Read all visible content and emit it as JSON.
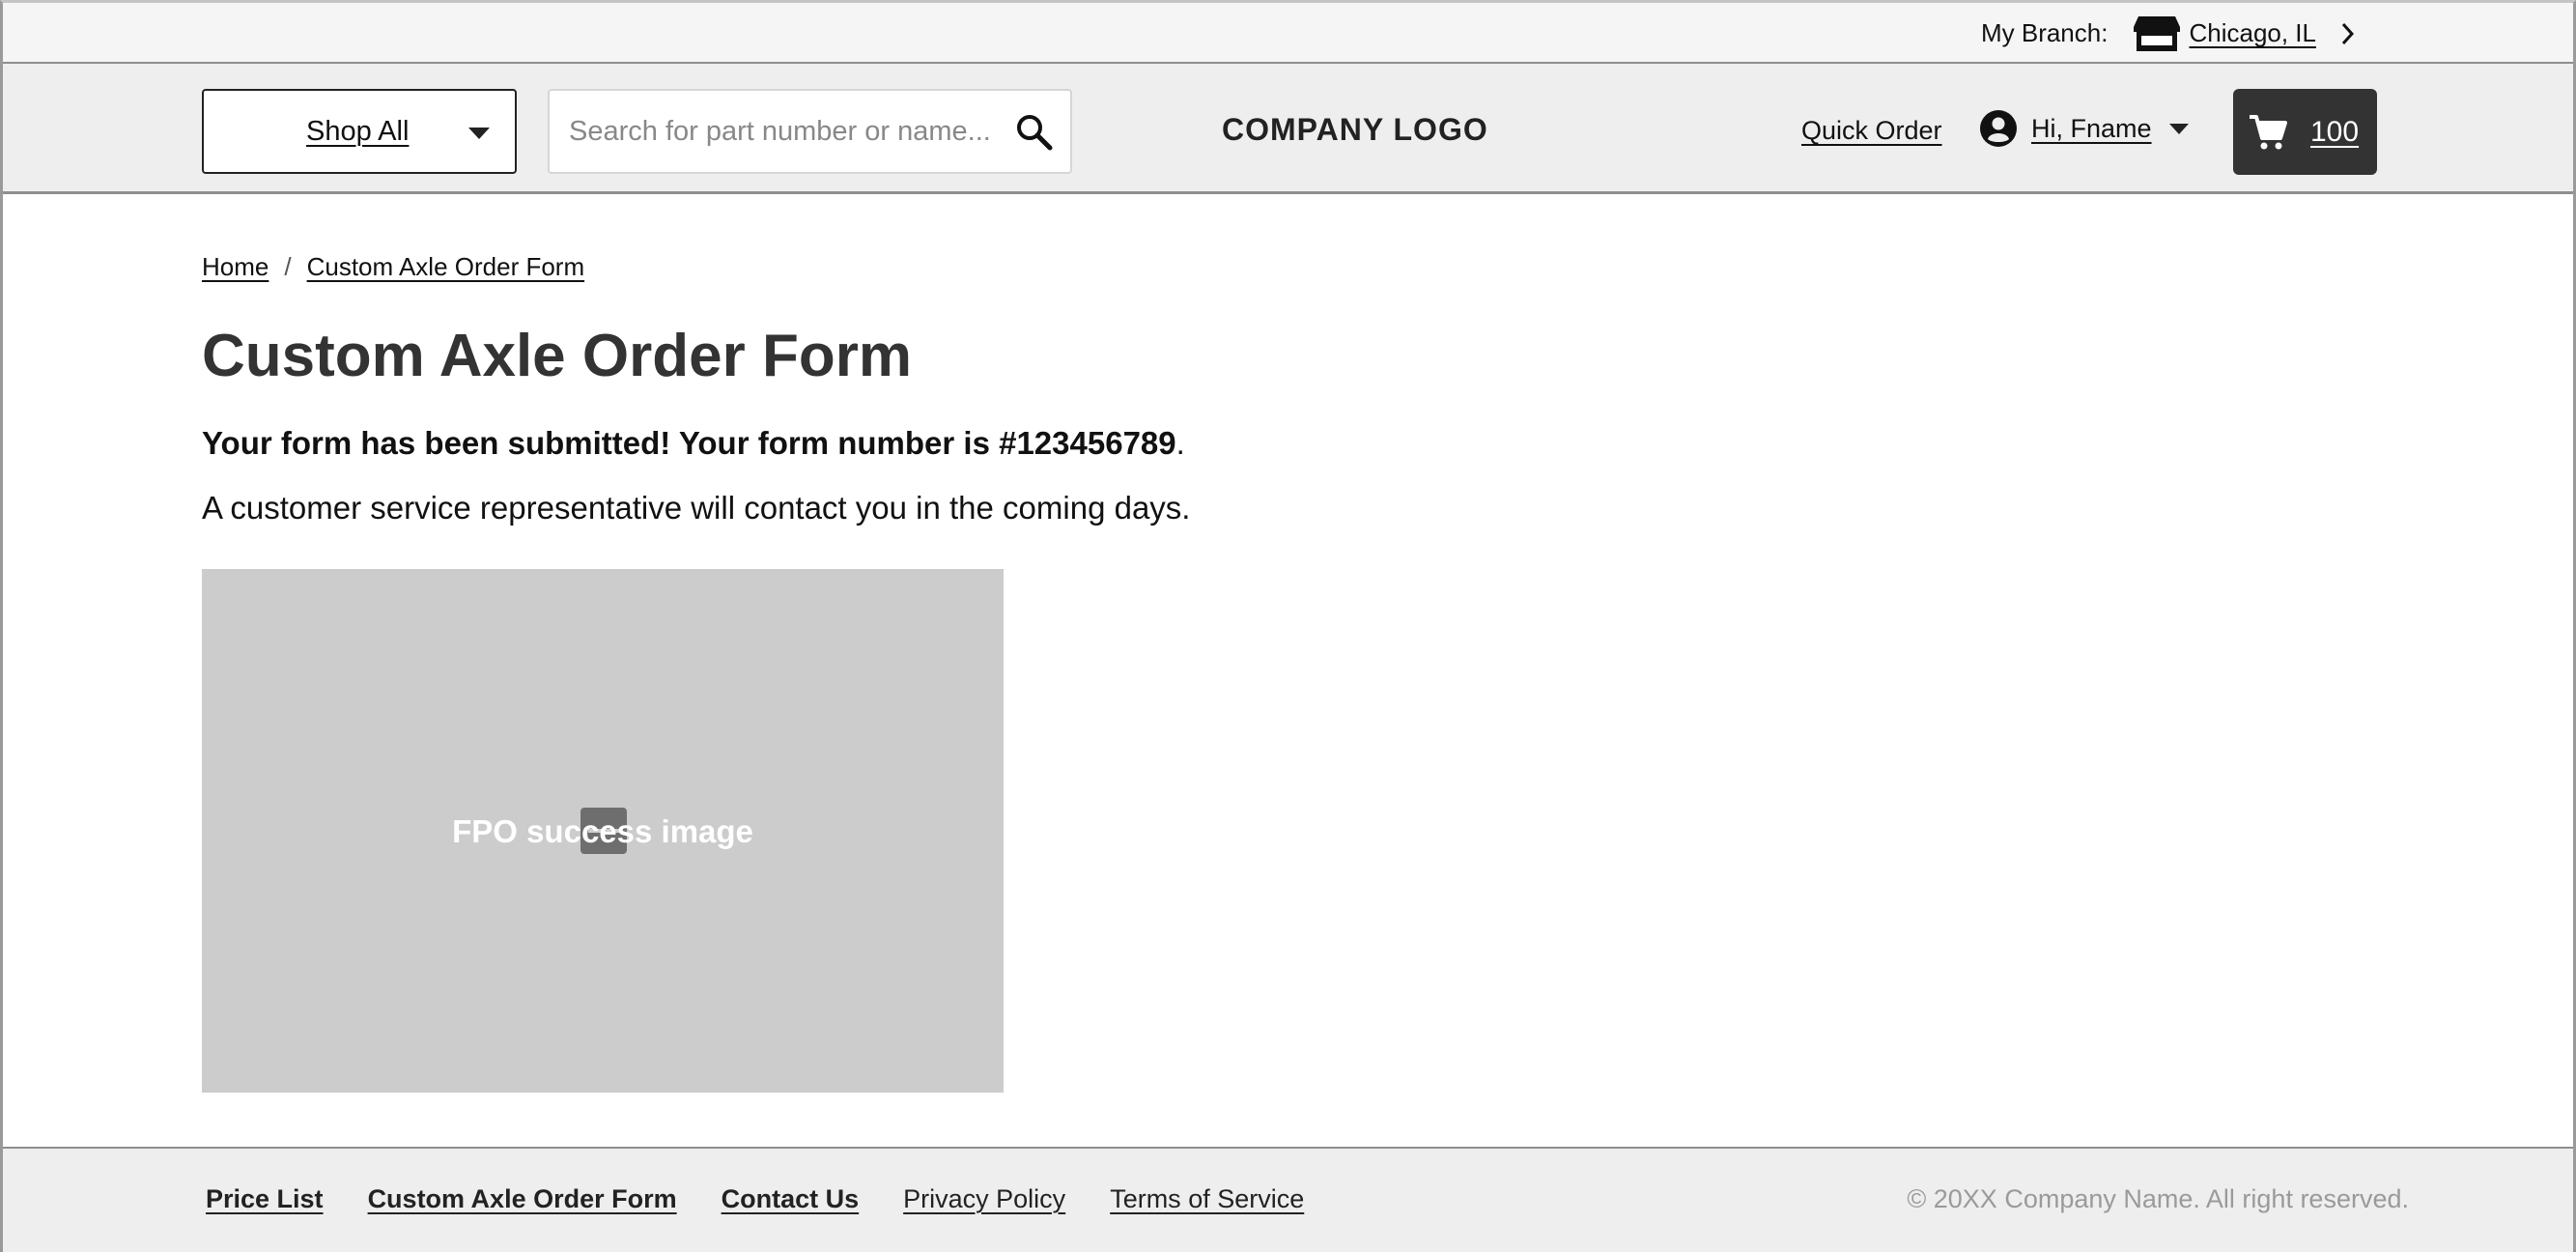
{
  "utility": {
    "branch_label": "My Branch:",
    "branch_name": "Chicago, IL"
  },
  "header": {
    "shop_all_label": "Shop All",
    "search_placeholder": "Search for part number or name...",
    "logo_text": "COMPANY LOGO",
    "quick_order_label": "Quick Order",
    "account_greeting": "Hi, Fname",
    "cart_count": "100"
  },
  "breadcrumb": {
    "items": [
      "Home",
      "Custom Axle Order Form"
    ],
    "separator": "/"
  },
  "main": {
    "title": "Custom Axle Order Form",
    "confirmation": "Your form has been submitted! Your form number is #123456789",
    "confirmation_end": ".",
    "subtext": "A customer service representative will contact you in the coming days.",
    "image_caption": "FPO success image"
  },
  "footer": {
    "links": [
      "Price List",
      "Custom Axle Order Form",
      "Contact Us",
      "Privacy Policy",
      "Terms of Service"
    ],
    "copyright": "© 20XX Company Name. All right reserved."
  },
  "colors": {
    "header_bg": "#eeeeee",
    "cart_bg": "#333333",
    "image_placeholder": "#cccccc",
    "muted_text": "#9a9a9a"
  },
  "icons": [
    "store-icon",
    "chevron-right-icon",
    "chevron-down-icon",
    "search-icon",
    "account-icon",
    "cart-icon",
    "image-icon"
  ]
}
